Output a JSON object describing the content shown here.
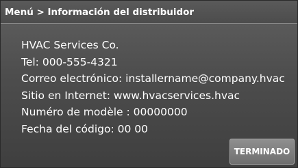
{
  "header": {
    "title": "Menú > Información del distribuidor"
  },
  "dealer_info": {
    "lines": [
      "HVAC Services Co.",
      "Tel: 000-555-4321",
      "Correo electrónico: installername@company.hvac",
      "Sitio en Internet: www.hvacservices.hvac",
      "Numéro de modèle : 00000000",
      "Fecha del código: 00 00"
    ]
  },
  "actions": {
    "done_label": "TERMINADO"
  }
}
